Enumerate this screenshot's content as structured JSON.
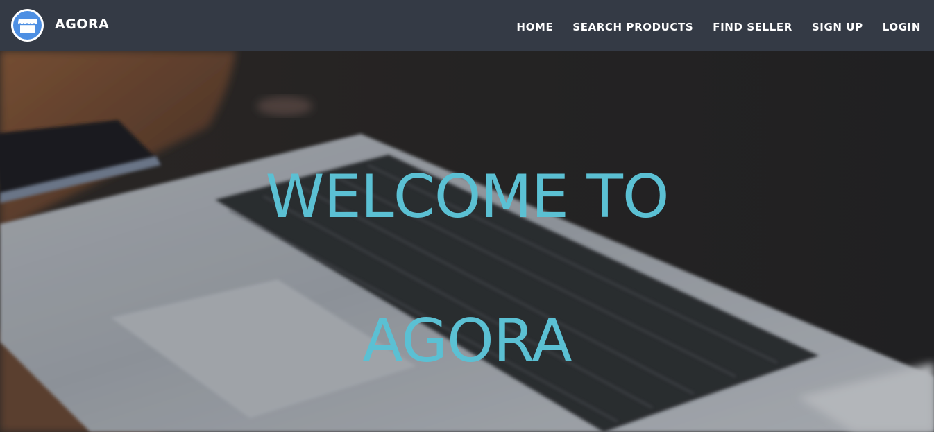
{
  "navbar": {
    "brand": {
      "name": "AGORA",
      "logo_icon": "storefront-icon"
    },
    "links": [
      {
        "label": "HOME"
      },
      {
        "label": "SEARCH PRODUCTS"
      },
      {
        "label": "FIND SELLER"
      },
      {
        "label": "SIGN UP"
      },
      {
        "label": "LOGIN"
      }
    ]
  },
  "hero": {
    "title_line1": "WELCOME TO",
    "title_line2": "AGORA",
    "background_image": "laptop-keyboard-photo"
  },
  "colors": {
    "navbar_bg": "#343a45",
    "accent_teal": "#5bc0d3",
    "logo_blue": "#4d8fe3",
    "nav_text": "#ffffff"
  }
}
